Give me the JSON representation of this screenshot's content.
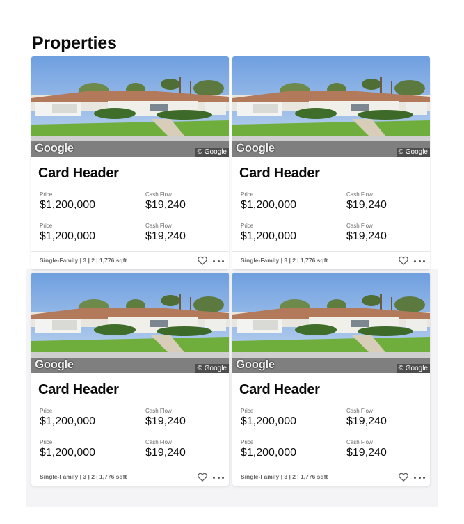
{
  "page": {
    "title": "Properties"
  },
  "photo": {
    "logo_text": "Google",
    "copyright_text": "© Google"
  },
  "cards": [
    {
      "header": "Card Header",
      "stats": [
        {
          "label": "Price",
          "value": "$1,200,000"
        },
        {
          "label": "Cash Flow",
          "value": "$19,240"
        },
        {
          "label": "Price",
          "value": "$1,200,000"
        },
        {
          "label": "Cash Flow",
          "value": "$19,240"
        }
      ],
      "summary": "Single-Family | 3 | 2 | 1,776 sqft"
    },
    {
      "header": "Card Header",
      "stats": [
        {
          "label": "Price",
          "value": "$1,200,000"
        },
        {
          "label": "Cash Flow",
          "value": "$19,240"
        },
        {
          "label": "Price",
          "value": "$1,200,000"
        },
        {
          "label": "Cash Flow",
          "value": "$19,240"
        }
      ],
      "summary": "Single-Family | 3 | 2 | 1,776 sqft"
    },
    {
      "header": "Card Header",
      "stats": [
        {
          "label": "Price",
          "value": "$1,200,000"
        },
        {
          "label": "Cash Flow",
          "value": "$19,240"
        },
        {
          "label": "Price",
          "value": "$1,200,000"
        },
        {
          "label": "Cash Flow",
          "value": "$19,240"
        }
      ],
      "summary": "Single-Family | 3 | 2 | 1,776 sqft"
    },
    {
      "header": "Card Header",
      "stats": [
        {
          "label": "Price",
          "value": "$1,200,000"
        },
        {
          "label": "Cash Flow",
          "value": "$19,240"
        },
        {
          "label": "Price",
          "value": "$1,200,000"
        },
        {
          "label": "Cash Flow",
          "value": "$19,240"
        }
      ],
      "summary": "Single-Family | 3 | 2 | 1,776 sqft"
    }
  ],
  "icons": {
    "favorite": "heart-icon",
    "more": "more-horizontal-icon"
  },
  "colors": {
    "sky": "#8fb4e6",
    "lawn": "#6fae3c",
    "roof": "#b87a5c",
    "road": "#8a8a8a"
  }
}
